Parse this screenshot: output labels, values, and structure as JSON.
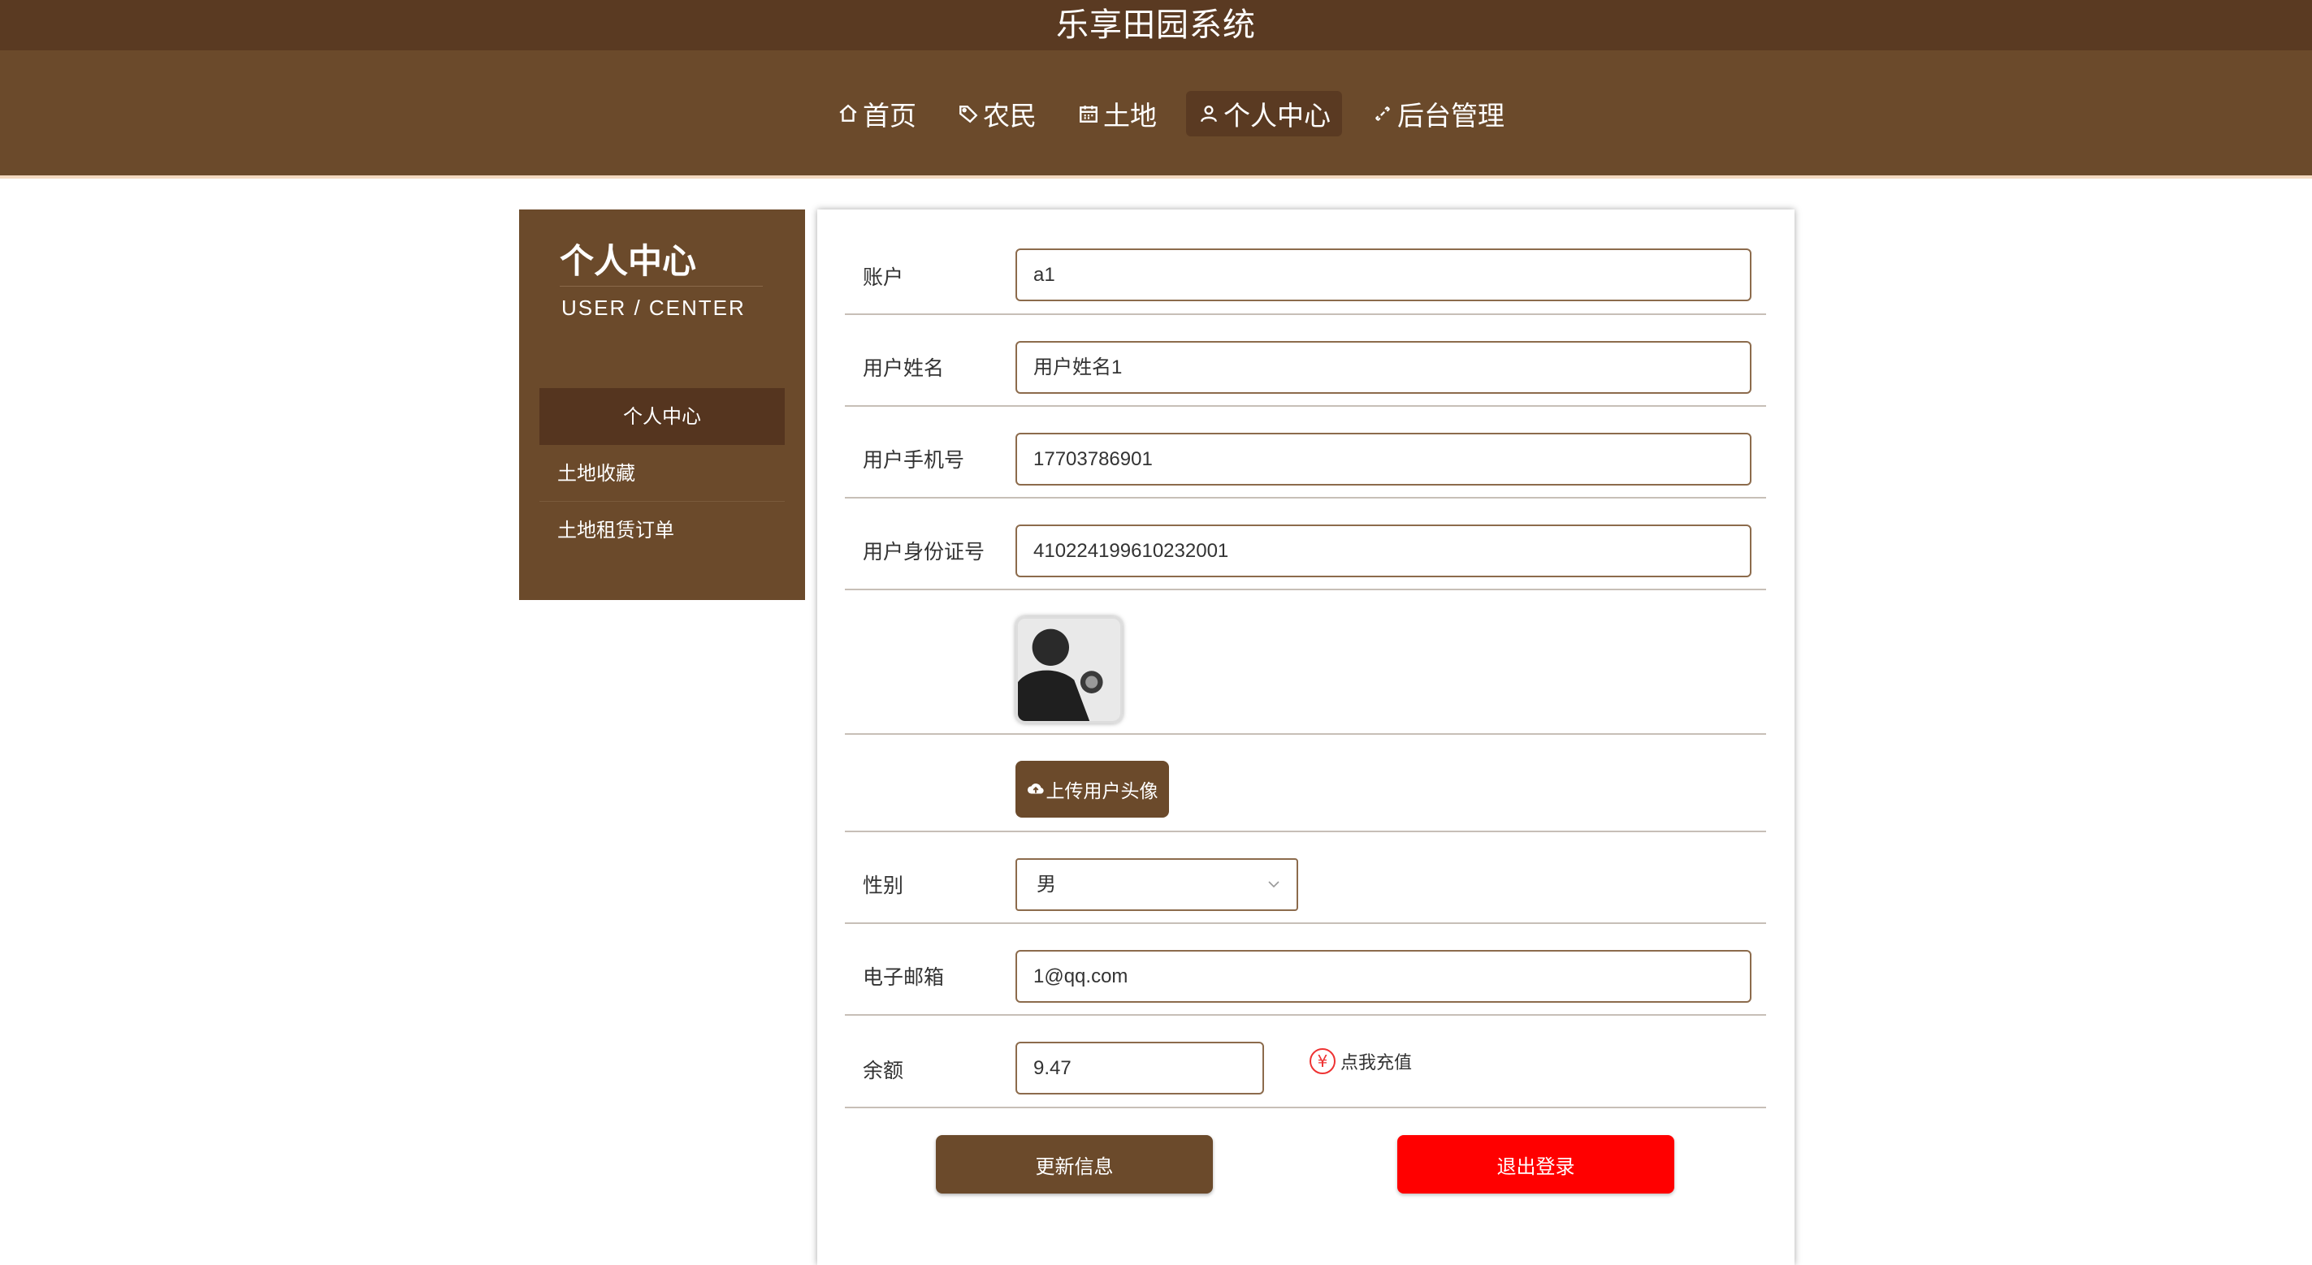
{
  "app": {
    "title": "乐享田园系统"
  },
  "nav": {
    "items": [
      {
        "label": "首页",
        "icon": "home-icon"
      },
      {
        "label": "农民",
        "icon": "tag-icon"
      },
      {
        "label": "土地",
        "icon": "calendar-icon"
      },
      {
        "label": "个人中心",
        "icon": "user-icon",
        "active": true
      },
      {
        "label": "后台管理",
        "icon": "link-icon"
      }
    ]
  },
  "sidebar": {
    "title": "个人中心",
    "subtitle": "USER / CENTER",
    "items": [
      {
        "label": "个人中心",
        "active": true
      },
      {
        "label": "土地收藏"
      },
      {
        "label": "土地租赁订单"
      }
    ]
  },
  "form": {
    "account_label": "账户",
    "account_value": "a1",
    "name_label": "用户姓名",
    "name_value": "用户姓名1",
    "phone_label": "用户手机号",
    "phone_value": "17703786901",
    "idcard_label": "用户身份证号",
    "idcard_value": "410224199610232001",
    "upload_label": "上传用户头像",
    "gender_label": "性别",
    "gender_value": "男",
    "email_label": "电子邮箱",
    "email_value": "1@qq.com",
    "balance_label": "余额",
    "balance_value": "9.47",
    "recharge_label": "点我充值",
    "recharge_symbol": "¥",
    "update_button": "更新信息",
    "logout_button": "退出登录"
  },
  "colors": {
    "header_dark": "#5a3a22",
    "header": "#6b4a2b",
    "danger": "#ff0000"
  }
}
